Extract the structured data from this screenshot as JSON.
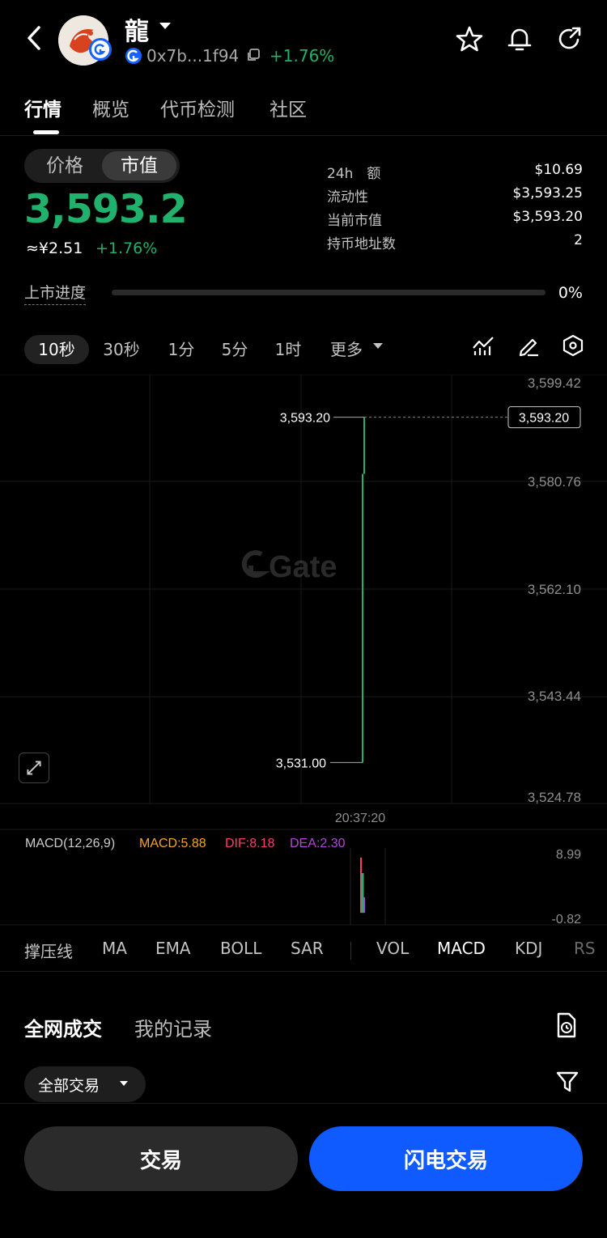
{
  "header": {
    "token_name": "龍",
    "address": "0x7b...1f94",
    "change_pct": "+1.76%"
  },
  "tabs": [
    "行情",
    "概览",
    "代币检测",
    "社区"
  ],
  "price_toggle": {
    "price_label": "价格",
    "mcap_label": "市值",
    "selected": "市值"
  },
  "main": {
    "value": "3,593.2",
    "cny": "≈¥2.51",
    "change_pct": "+1.76%"
  },
  "stats": [
    {
      "label": "24h　额",
      "value": "$10.69"
    },
    {
      "label": "流动性",
      "value": "$3,593.25"
    },
    {
      "label": "当前市值",
      "value": "$3,593.20"
    },
    {
      "label": "持币地址数",
      "value": "2"
    }
  ],
  "listing_progress": {
    "label": "上市进度",
    "value": "0%",
    "fraction": 0
  },
  "intervals": [
    "10秒",
    "30秒",
    "1分",
    "5分",
    "1时",
    "更多"
  ],
  "selected_interval": "10秒",
  "chart_data": {
    "type": "line",
    "watermark": "Gate",
    "y_ticks": [
      "3,599.42",
      "3,580.76",
      "3,562.10",
      "3,543.44",
      "3,524.78"
    ],
    "ylim": [
      3524.78,
      3599.42
    ],
    "x_label": "20:37:20",
    "current_price": "3,593.20",
    "high_label": "3,593.20",
    "low_label": "3,531.00",
    "candle": {
      "open": 3531.0,
      "close": 3593.2,
      "high": 3593.2,
      "low": 3531.0
    },
    "macd": {
      "title": "MACD(12,26,9)",
      "macd_label": "MACD:5.88",
      "dif_label": "DIF:8.18",
      "dea_label": "DEA:2.30",
      "macd": 5.88,
      "dif": 8.18,
      "dea": 2.3,
      "y_ticks": [
        "8.99",
        "-0.82"
      ]
    }
  },
  "indicators": [
    "撑压线",
    "MA",
    "EMA",
    "BOLL",
    "SAR",
    "VOL",
    "MACD",
    "KDJ",
    "RS"
  ],
  "active_indicator": "MACD",
  "trades": {
    "tabs": [
      "全网成交",
      "我的记录"
    ],
    "filter": "全部交易"
  },
  "buttons": {
    "trade": "交易",
    "flash_trade": "闪电交易"
  },
  "colors": {
    "up": "#20b26c",
    "accent": "#0f5bff",
    "macd": "#f5a623",
    "dif": "#ff3b6b",
    "dea": "#b246d9"
  }
}
